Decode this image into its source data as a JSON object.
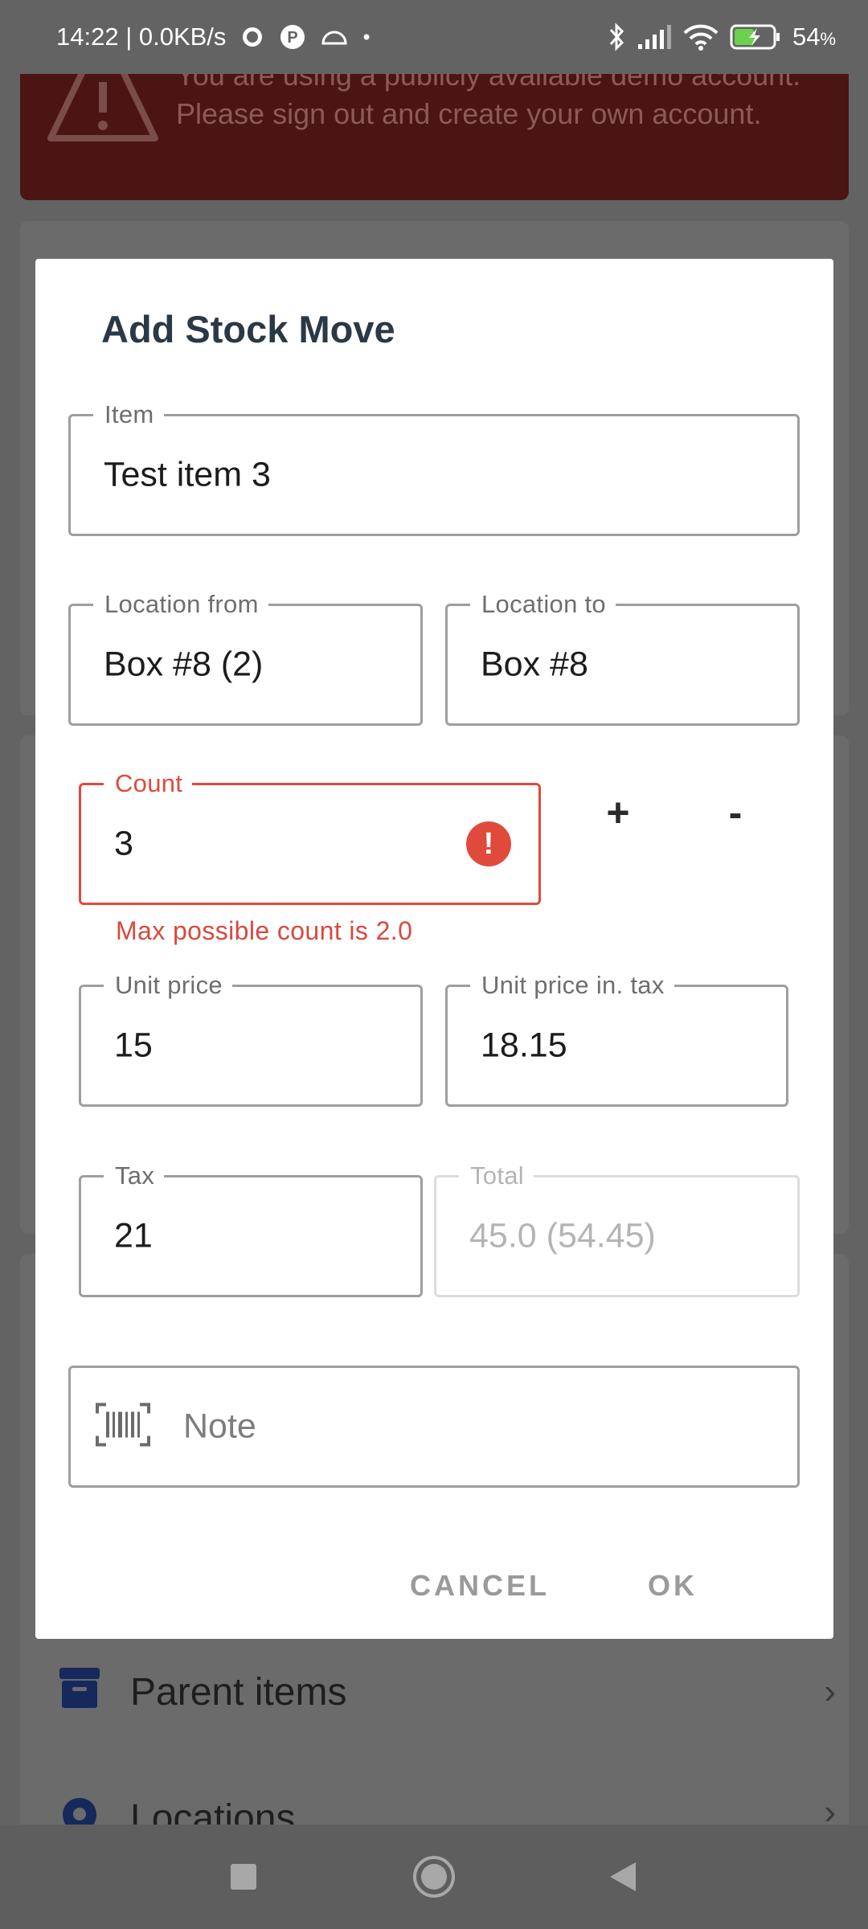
{
  "status_bar": {
    "time_speed": "14:22 | 0.0KB/s",
    "battery": "54",
    "battery_unit": "%",
    "icons": [
      "chat-bubble-icon",
      "p-badge-icon",
      "cloud-icon",
      "dot-icon",
      "bluetooth-icon",
      "signal-icon",
      "wifi-icon",
      "battery-charging-icon"
    ]
  },
  "background": {
    "demo_banner": "You are using a publicly available demo account. Please sign out and create your own account.",
    "list": [
      {
        "label": "Parent items",
        "icon": "box-icon"
      },
      {
        "label": "Locations",
        "icon": "location-pin-icon"
      }
    ]
  },
  "dialog": {
    "title": "Add Stock Move",
    "item": {
      "label": "Item",
      "value": "Test item 3"
    },
    "location_from": {
      "label": "Location from",
      "value": "Box #8 (2)"
    },
    "location_to": {
      "label": "Location to",
      "value": "Box #8"
    },
    "count": {
      "label": "Count",
      "value": "3",
      "error": "Max possible count is 2.0",
      "error_icon": "!"
    },
    "stepper": {
      "plus": "+",
      "minus": "-"
    },
    "unit_price": {
      "label": "Unit price",
      "value": "15"
    },
    "unit_price_tax": {
      "label": "Unit price in. tax",
      "value": "18.15"
    },
    "tax": {
      "label": "Tax",
      "value": "21"
    },
    "total": {
      "label": "Total",
      "value": "45.0 (54.45)"
    },
    "note": {
      "placeholder": "Note",
      "icon": "barcode-scan-icon"
    },
    "cancel_label": "CANCEL",
    "ok_label": "OK"
  },
  "colors": {
    "error": "#e04a3c",
    "title": "#2b3845",
    "banner": "#4b1513",
    "scrim_bg": "#636363"
  }
}
